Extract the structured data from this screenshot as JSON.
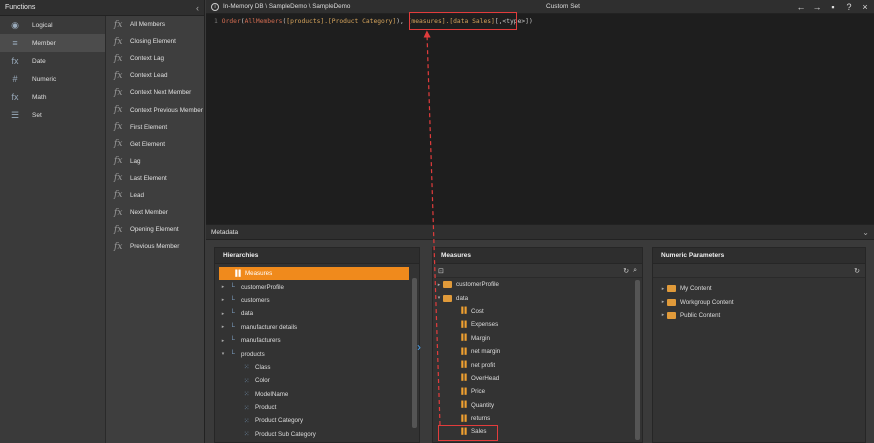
{
  "functions": {
    "title": "Functions",
    "collapse_icon": "chevron-left-icon",
    "categories": [
      {
        "label": "Logical",
        "icon": "logical-icon",
        "glyph": "◉",
        "selected": false
      },
      {
        "label": "Member",
        "icon": "member-icon",
        "glyph": "≡",
        "selected": true
      },
      {
        "label": "Date",
        "icon": "date-icon",
        "glyph": "fx",
        "selected": false
      },
      {
        "label": "Numeric",
        "icon": "numeric-icon",
        "glyph": "#",
        "selected": false
      },
      {
        "label": "Math",
        "icon": "math-icon",
        "glyph": "fx",
        "selected": false
      },
      {
        "label": "Set",
        "icon": "set-icon",
        "glyph": "☰",
        "selected": false
      }
    ],
    "items": [
      "All Members",
      "Closing Element",
      "Context Lag",
      "Context Lead",
      "Context Next Member",
      "Context Previous Member",
      "First Element",
      "Get Element",
      "Lag",
      "Last Element",
      "Lead",
      "Next Member",
      "Opening Element",
      "Previous Member"
    ]
  },
  "editor": {
    "path": "In-Memory DB \\ SampleDemo \\ SampleDemo",
    "title": "Custom Set",
    "line_number": "1",
    "code": {
      "fn": "Order",
      "p1": "(",
      "fn2": "AllMembers",
      "p2": "(",
      "dim": "[products].[Product Category]",
      "p3": ")",
      "sep": ", ",
      "measure": "[measures].[data Sales]",
      "rest": "[,<type>])"
    }
  },
  "metadata": {
    "title": "Metadata",
    "hierarchies": {
      "title": "Hierarchies",
      "items": [
        {
          "label": "Measures",
          "level": 0,
          "type": "measure",
          "selected": true
        },
        {
          "label": "customerProfile",
          "level": 0,
          "type": "hier",
          "expand": "▸"
        },
        {
          "label": "customers",
          "level": 0,
          "type": "hier",
          "expand": "▸"
        },
        {
          "label": "data",
          "level": 0,
          "type": "hier",
          "expand": "▸"
        },
        {
          "label": "manufacturer details",
          "level": 0,
          "type": "hier",
          "expand": "▸"
        },
        {
          "label": "manufacturers",
          "level": 0,
          "type": "hier",
          "expand": "▸"
        },
        {
          "label": "products",
          "level": 0,
          "type": "hier",
          "expand": "▾"
        },
        {
          "label": "Class",
          "level": 1,
          "type": "level"
        },
        {
          "label": "Color",
          "level": 1,
          "type": "level"
        },
        {
          "label": "ModelName",
          "level": 1,
          "type": "level"
        },
        {
          "label": "Product",
          "level": 1,
          "type": "level"
        },
        {
          "label": "Product Category",
          "level": 1,
          "type": "level"
        },
        {
          "label": "Product Sub Category",
          "level": 1,
          "type": "level"
        }
      ]
    },
    "measures": {
      "title": "Measures",
      "items": [
        {
          "label": "customerProfile",
          "level": 0,
          "type": "folder",
          "expand": "▸"
        },
        {
          "label": "data",
          "level": 0,
          "type": "folder",
          "expand": "▾"
        },
        {
          "label": "Cost",
          "level": 1,
          "type": "measure"
        },
        {
          "label": "Expenses",
          "level": 1,
          "type": "measure"
        },
        {
          "label": "Margin",
          "level": 1,
          "type": "measure"
        },
        {
          "label": "net margin",
          "level": 1,
          "type": "measure"
        },
        {
          "label": "net profit",
          "level": 1,
          "type": "measure"
        },
        {
          "label": "OverHead",
          "level": 1,
          "type": "measure"
        },
        {
          "label": "Price",
          "level": 1,
          "type": "measure"
        },
        {
          "label": "Quantity",
          "level": 1,
          "type": "measure"
        },
        {
          "label": "returns",
          "level": 1,
          "type": "measure"
        },
        {
          "label": "Sales",
          "level": 1,
          "type": "measure"
        }
      ]
    },
    "numeric_parameters": {
      "title": "Numeric Parameters",
      "items": [
        {
          "label": "My Content"
        },
        {
          "label": "Workgroup Content"
        },
        {
          "label": "Public Content"
        }
      ]
    }
  }
}
